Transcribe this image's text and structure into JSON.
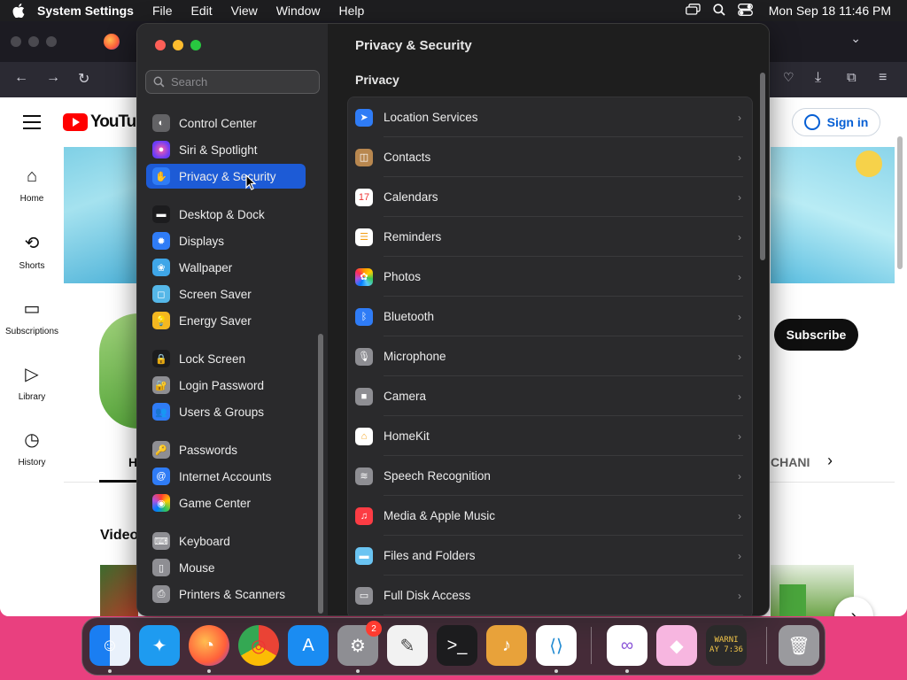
{
  "menubar": {
    "app_name": "System Settings",
    "menus": [
      "File",
      "Edit",
      "View",
      "Window",
      "Help"
    ],
    "clock": "Mon Sep 18  11:46 PM",
    "status_icons": [
      "screen-mirroring-icon",
      "spotlight-search-icon",
      "control-center-icon"
    ]
  },
  "browser": {
    "youtube": {
      "logo_text": "YouTube",
      "sidebar": [
        {
          "label": "Home",
          "icon": "home-icon"
        },
        {
          "label": "Shorts",
          "icon": "shorts-icon"
        },
        {
          "label": "Subscriptions",
          "icon": "subscriptions-icon"
        },
        {
          "label": "Library",
          "icon": "library-icon"
        },
        {
          "label": "History",
          "icon": "history-icon"
        }
      ],
      "sign_in": "Sign in",
      "subscribe": "Subscribe",
      "tab_home_partial": "H",
      "tab_channels_partial": "CHANI",
      "videos_partial": "Video"
    }
  },
  "settings": {
    "search_placeholder": "Search",
    "sidebar": [
      {
        "label": "Control Center",
        "color": "#636366",
        "icon": "control-center-icon"
      },
      {
        "label": "Siri & Spotlight",
        "color": "#b44bd1",
        "icon": "siri-icon"
      },
      {
        "label": "Privacy & Security",
        "color": "#2f7cf6",
        "icon": "hand-icon",
        "selected": true
      },
      {
        "label": "Desktop & Dock",
        "color": "#1c1c1e",
        "icon": "dock-icon"
      },
      {
        "label": "Displays",
        "color": "#2f7cf6",
        "icon": "sun-icon"
      },
      {
        "label": "Wallpaper",
        "color": "#3fa6e8",
        "icon": "wallpaper-icon"
      },
      {
        "label": "Screen Saver",
        "color": "#55b7e8",
        "icon": "screen-saver-icon"
      },
      {
        "label": "Energy Saver",
        "color": "#f5b820",
        "icon": "lightbulb-icon"
      },
      {
        "label": "Lock Screen",
        "color": "#1c1c1e",
        "icon": "lock-icon"
      },
      {
        "label": "Login Password",
        "color": "#8e8e93",
        "icon": "padlock-icon"
      },
      {
        "label": "Users & Groups",
        "color": "#2f7cf6",
        "icon": "users-icon"
      },
      {
        "label": "Passwords",
        "color": "#8e8e93",
        "icon": "key-icon"
      },
      {
        "label": "Internet Accounts",
        "color": "#2f7cf6",
        "icon": "at-icon"
      },
      {
        "label": "Game Center",
        "color": "#e9e9ea",
        "icon": "game-center-icon"
      },
      {
        "label": "Keyboard",
        "color": "#8e8e93",
        "icon": "keyboard-icon"
      },
      {
        "label": "Mouse",
        "color": "#8e8e93",
        "icon": "mouse-icon"
      },
      {
        "label": "Printers & Scanners",
        "color": "#8e8e93",
        "icon": "printer-icon"
      }
    ],
    "main": {
      "title": "Privacy & Security",
      "section": "Privacy",
      "rows": [
        {
          "label": "Location Services",
          "color": "#2f7cf6",
          "icon": "location-arrow-icon"
        },
        {
          "label": "Contacts",
          "color": "#b8874f",
          "icon": "contacts-icon"
        },
        {
          "label": "Calendars",
          "color": "#ffffff",
          "icon": "calendar-icon"
        },
        {
          "label": "Reminders",
          "color": "#ffffff",
          "icon": "reminders-icon"
        },
        {
          "label": "Photos",
          "color": "#ffffff",
          "icon": "photos-icon"
        },
        {
          "label": "Bluetooth",
          "color": "#2f7cf6",
          "icon": "bluetooth-icon"
        },
        {
          "label": "Microphone",
          "color": "#8e8e93",
          "icon": "microphone-icon"
        },
        {
          "label": "Camera",
          "color": "#8e8e93",
          "icon": "camera-icon"
        },
        {
          "label": "HomeKit",
          "color": "#ffffff",
          "icon": "home-icon"
        },
        {
          "label": "Speech Recognition",
          "color": "#8e8e93",
          "icon": "waveform-icon"
        },
        {
          "label": "Media & Apple Music",
          "color": "#fc3c44",
          "icon": "music-note-icon"
        },
        {
          "label": "Files and Folders",
          "color": "#6ac4f2",
          "icon": "folder-icon"
        },
        {
          "label": "Full Disk Access",
          "color": "#8e8e93",
          "icon": "disk-icon"
        }
      ]
    }
  },
  "dock": {
    "apps": [
      {
        "name": "Finder",
        "icon": "finder-icon",
        "color": "#2b8cf5",
        "running": true
      },
      {
        "name": "Safari",
        "icon": "safari-icon",
        "color": "#1e9bf0",
        "running": false
      },
      {
        "name": "Firefox",
        "icon": "firefox-icon",
        "color": "#ff7139",
        "running": true
      },
      {
        "name": "Chrome",
        "icon": "chrome-icon",
        "color": "#ffffff",
        "running": false
      },
      {
        "name": "App Store",
        "icon": "app-store-icon",
        "color": "#1a8cf2",
        "running": false
      },
      {
        "name": "System Settings",
        "icon": "system-settings-icon",
        "color": "#8e8e93",
        "running": true,
        "badge": "2"
      },
      {
        "name": "TextEdit",
        "icon": "textedit-icon",
        "color": "#f2f2f2",
        "running": false
      },
      {
        "name": "Terminal",
        "icon": "terminal-icon",
        "color": "#1c1c1e",
        "running": false
      },
      {
        "name": "GarageBand",
        "icon": "guitar-icon",
        "color": "#e8a23a",
        "running": false
      },
      {
        "name": "Visual Studio Code",
        "icon": "vscode-icon",
        "color": "#ffffff",
        "running": true
      },
      {
        "name": "Visual Studio",
        "icon": "visual-studio-icon",
        "color": "#ffffff",
        "running": true
      },
      {
        "name": "Sketchbook",
        "icon": "sketch-icon",
        "color": "#f7b6e0",
        "running": false
      },
      {
        "name": "Console",
        "icon": "console-icon",
        "color": "#2a2a2a",
        "running": false,
        "text": "WARNI AY 7:36"
      },
      {
        "name": "Trash",
        "icon": "trash-icon",
        "color": "#9a9a9e",
        "running": false
      }
    ]
  }
}
